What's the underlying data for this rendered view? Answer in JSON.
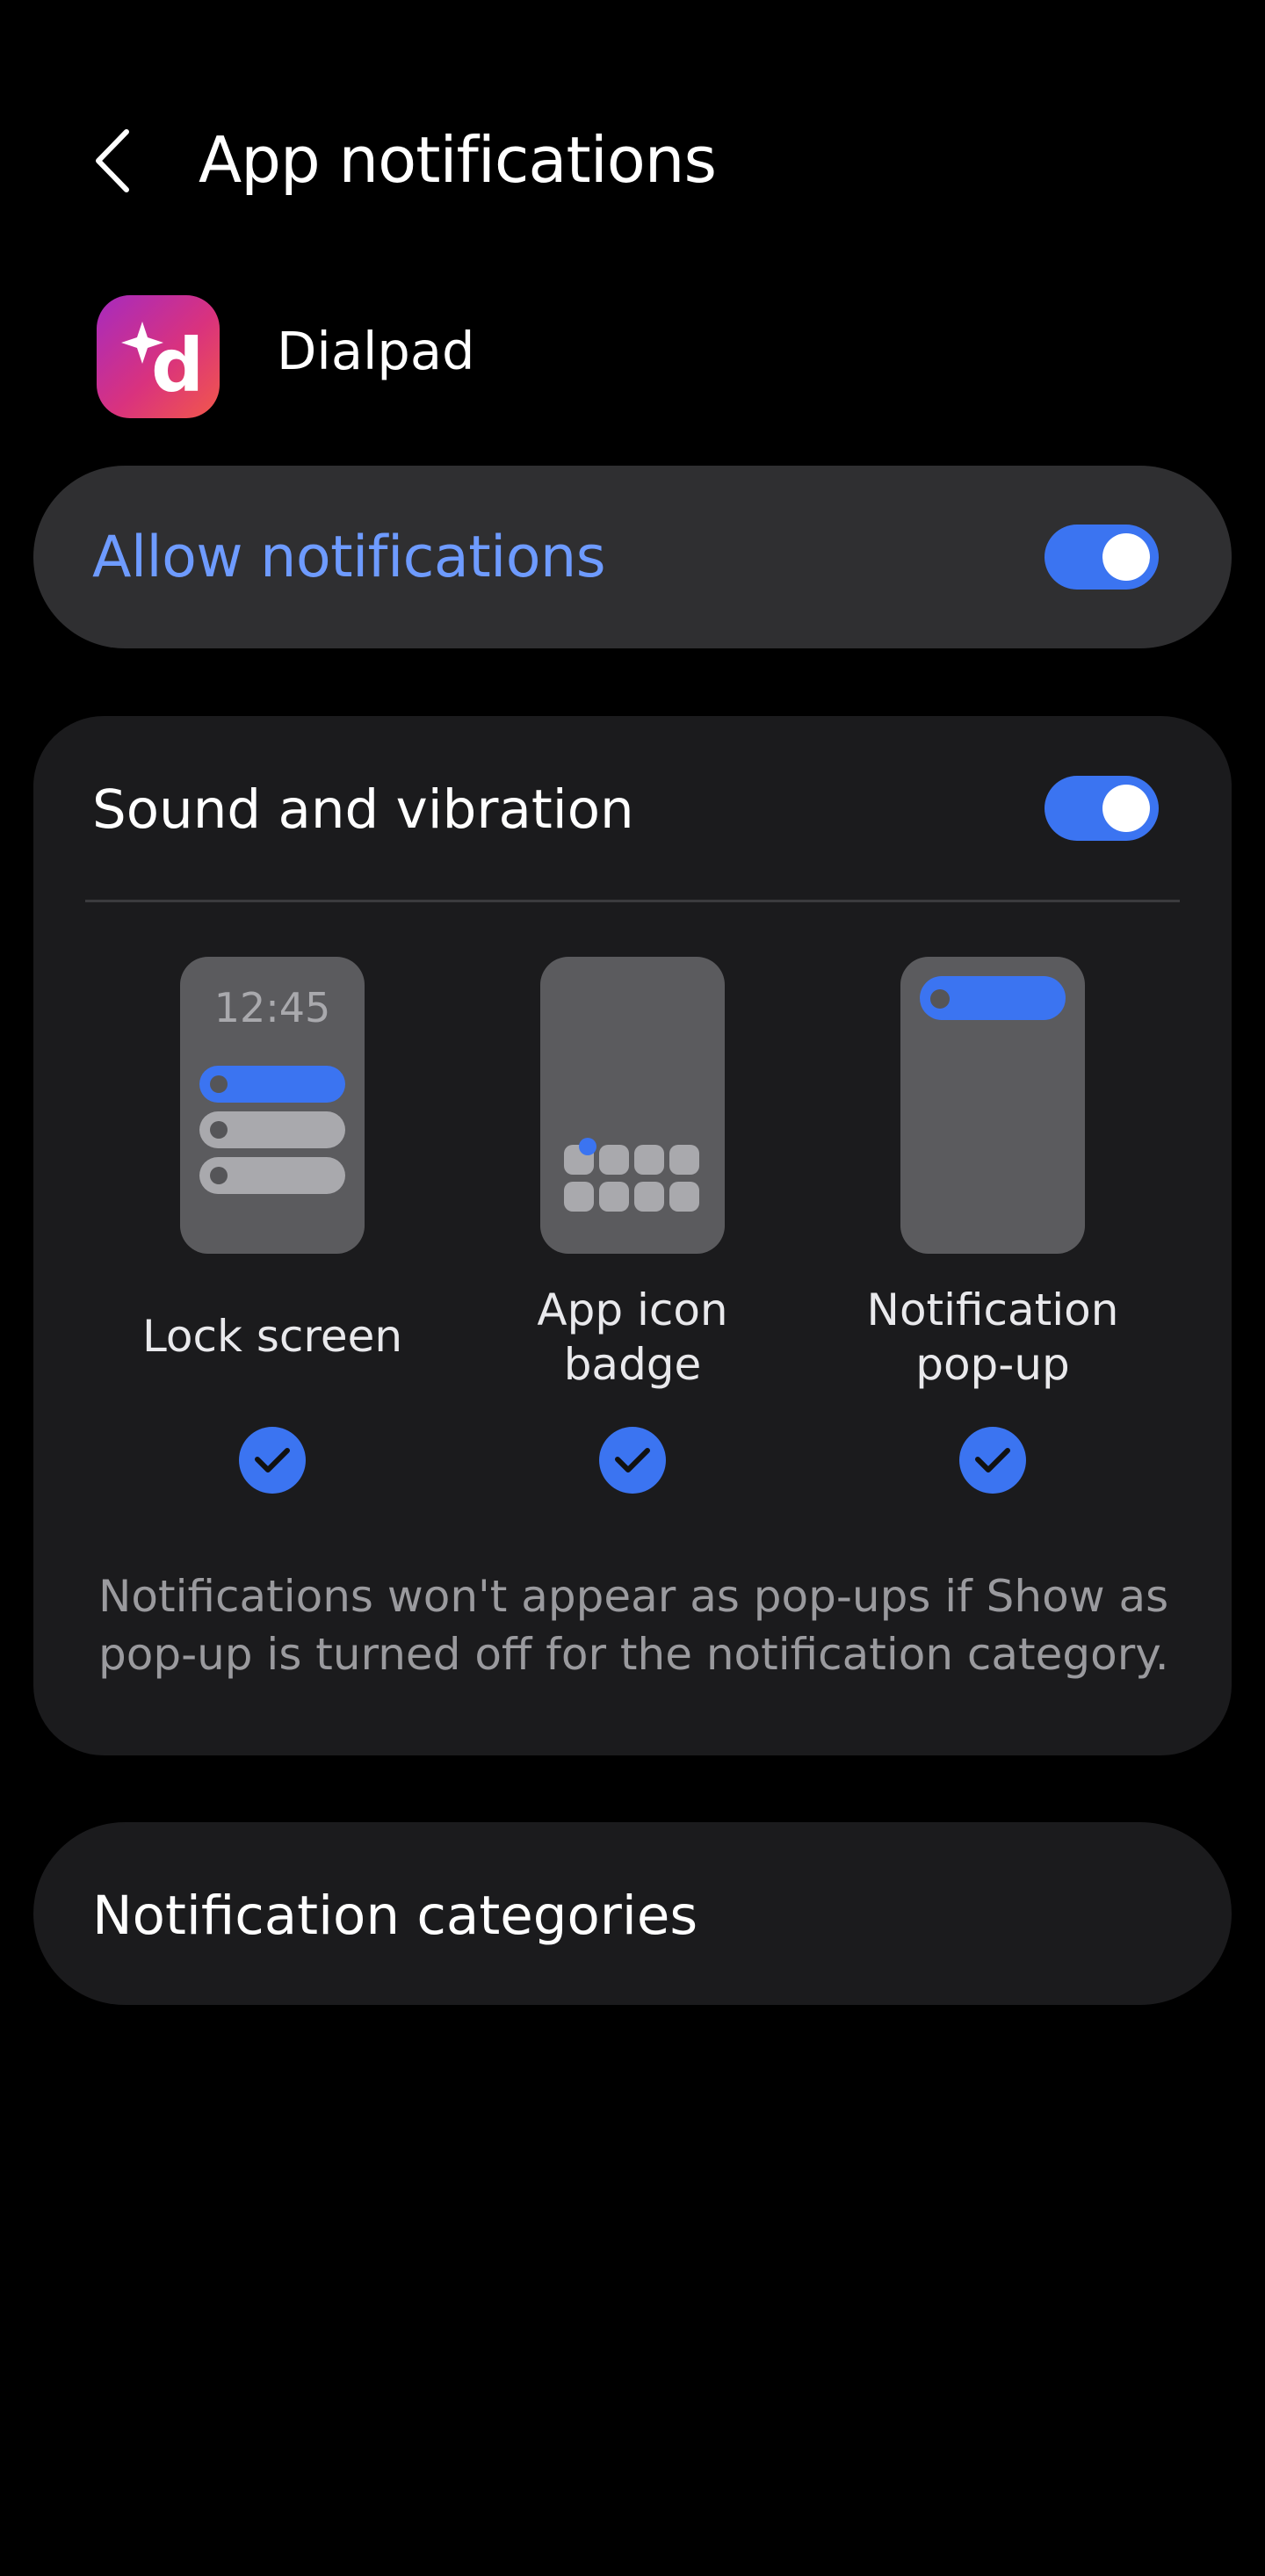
{
  "header": {
    "title": "App notifications",
    "back_icon": "chevron-left-icon"
  },
  "app": {
    "name": "Dialpad",
    "icon_letter": "d",
    "icon": "dialpad-app-icon"
  },
  "allow_notifications": {
    "label": "Allow notifications",
    "enabled": true
  },
  "sound_and_vibration": {
    "label": "Sound and vibration",
    "enabled": true
  },
  "styles": [
    {
      "label_line1": "Lock screen",
      "label_line2": "",
      "clock": "12:45",
      "selected": true
    },
    {
      "label_line1": "App icon",
      "label_line2": "badge",
      "selected": true
    },
    {
      "label_line1": "Notification",
      "label_line2": "pop-up",
      "selected": true
    }
  ],
  "footnote": "Notifications won't appear as pop-ups if Show as pop-up is turned off for the notification category.",
  "notification_categories": {
    "label": "Notification categories"
  },
  "colors": {
    "accent": "#3b74f1",
    "accent_text": "#6e9bff",
    "card": "#1b1b1d",
    "card_highlight": "#2f2f31"
  }
}
